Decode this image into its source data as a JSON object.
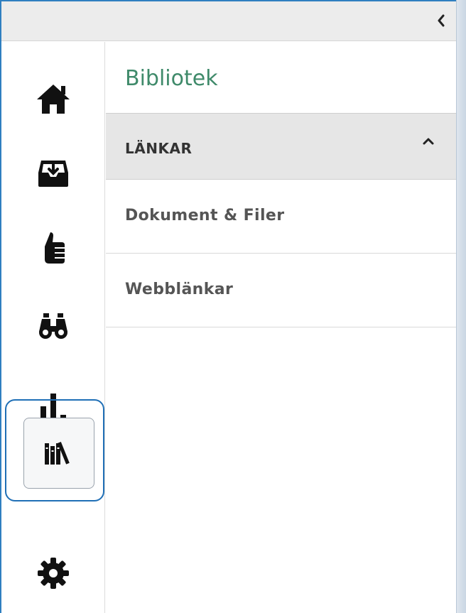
{
  "topbar": {
    "collapse_icon": "chevron-left-icon"
  },
  "rail": {
    "items": [
      {
        "icon": "home-icon"
      },
      {
        "icon": "inbox-icon"
      },
      {
        "icon": "thumbs-up-icon"
      },
      {
        "icon": "binoculars-icon"
      },
      {
        "icon": "bar-chart-icon"
      },
      {
        "icon": "library-icon",
        "active": true
      },
      {
        "icon": "gear-icon"
      }
    ]
  },
  "panel": {
    "title": "Bibliotek",
    "section": {
      "label": "LÄNKAR",
      "chevron": "chevron-up-icon",
      "expanded": true
    },
    "items": [
      {
        "label": "Dokument & Filer"
      },
      {
        "label": "Webblänkar"
      }
    ]
  },
  "colors": {
    "title": "#3f8a6a",
    "active_outline": "#1f6fb6",
    "section_bg": "#e6e6e6",
    "topbar_bg": "#ececec"
  }
}
